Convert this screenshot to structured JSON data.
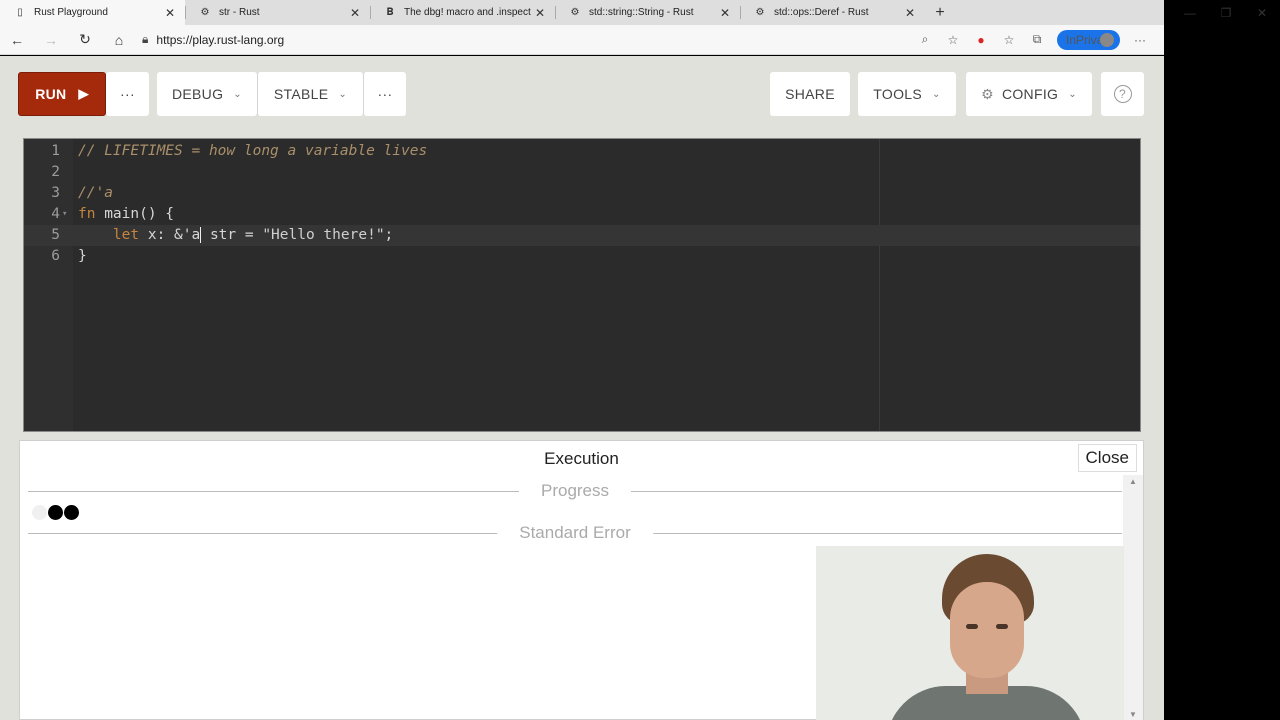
{
  "browser": {
    "tabs": [
      {
        "label": "Rust Playground",
        "icon": "page-icon",
        "active": true
      },
      {
        "label": "str - Rust",
        "icon": "docs-rs-icon",
        "active": false
      },
      {
        "label": "The dbg! macro and .inspect - E",
        "icon": "book-icon",
        "active": false
      },
      {
        "label": "std::string::String - Rust",
        "icon": "docs-rs-icon",
        "active": false
      },
      {
        "label": "std::ops::Deref - Rust",
        "icon": "docs-rs-icon",
        "active": false
      }
    ],
    "url": "https://play.rust-lang.org",
    "inprivate_label": "InPrivate"
  },
  "toolbar": {
    "run_label": "RUN",
    "debug_label": "DEBUG",
    "stable_label": "STABLE",
    "share_label": "SHARE",
    "tools_label": "TOOLS",
    "config_label": "CONFIG",
    "more_label": "···",
    "help_label": "?"
  },
  "editor": {
    "lines": [
      {
        "n": "1",
        "text": "// LIFETIMES = how long a variable lives"
      },
      {
        "n": "2",
        "text": ""
      },
      {
        "n": "3",
        "text": "//'a"
      },
      {
        "n": "4",
        "kw": "fn",
        "rest": " main() {"
      },
      {
        "n": "5",
        "kw": "    let",
        "mid": " x: &'a",
        "after": " str = ",
        "str": "\"Hello there!\"",
        "end": ";"
      },
      {
        "n": "6",
        "text": "}"
      }
    ]
  },
  "output": {
    "title": "Execution",
    "close_label": "Close",
    "progress_label": "Progress",
    "stderr_label": "Standard Error"
  },
  "colors": {
    "run_button": "#a52a0c",
    "editor_bg": "#2b2b2b",
    "app_bg": "#e1e1db",
    "inprivate": "#1a73e8"
  }
}
